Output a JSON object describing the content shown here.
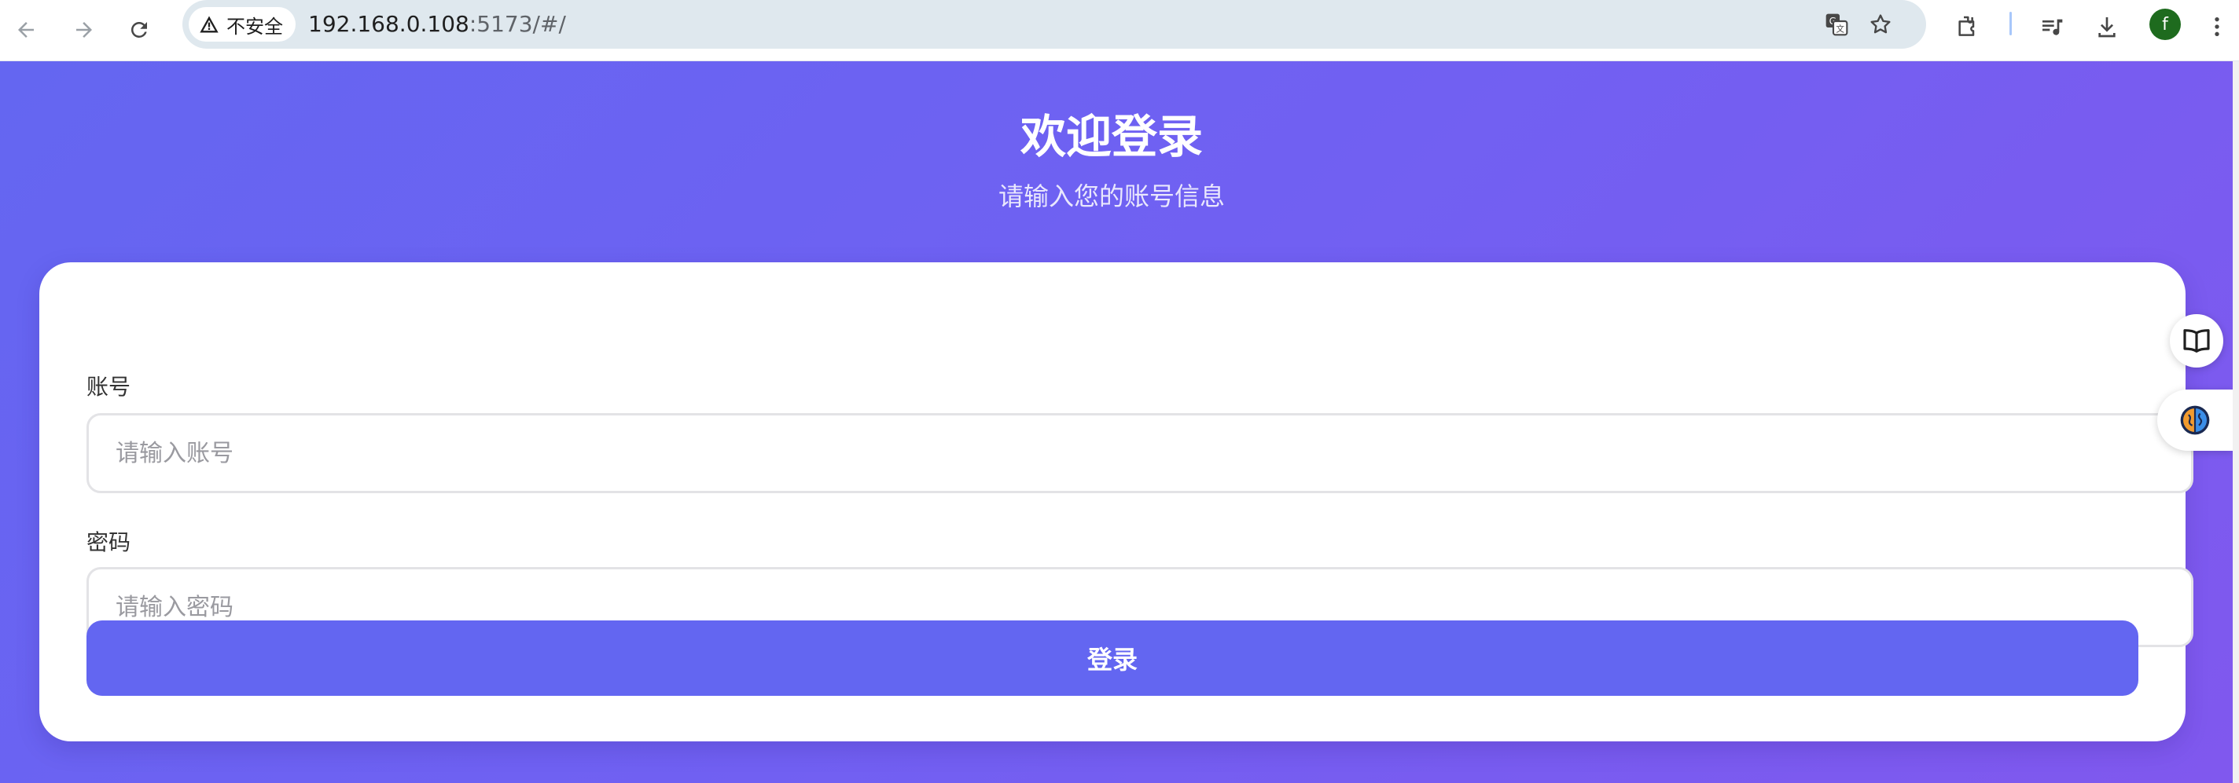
{
  "browser": {
    "security_label": "不安全",
    "url_host": "192.168.0.108",
    "url_rest": ":5173/#/",
    "profile_initial": "f"
  },
  "login": {
    "title": "欢迎登录",
    "subtitle": "请输入您的账号信息",
    "account_label": "账号",
    "account_placeholder": "请输入账号",
    "account_value": "",
    "password_label": "密码",
    "password_placeholder": "请输入密码",
    "password_value": "",
    "submit_label": "登录"
  },
  "colors": {
    "accent": "#6366f1",
    "gradient_start": "#6466f1",
    "gradient_end": "#8058ee"
  },
  "icons": [
    "back-icon",
    "forward-icon",
    "reload-icon",
    "warning-icon",
    "translate-icon",
    "bookmark-star-icon",
    "extensions-icon",
    "media-queue-icon",
    "download-icon",
    "more-menu-icon",
    "book-icon",
    "brain-icon"
  ]
}
